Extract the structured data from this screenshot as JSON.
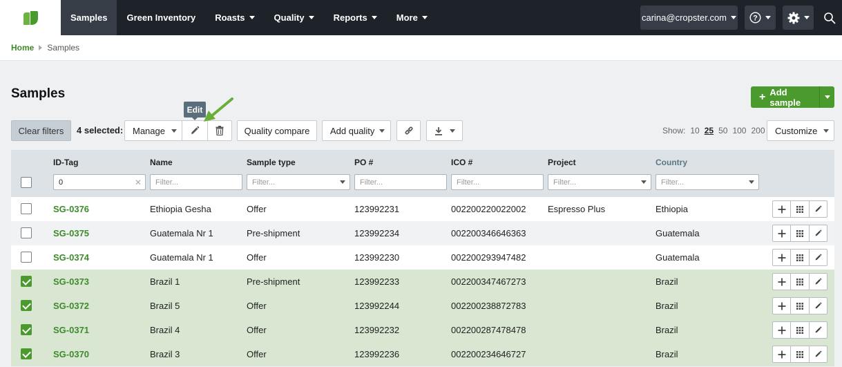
{
  "nav": {
    "items": [
      {
        "label": "Samples",
        "active": true,
        "caret": false
      },
      {
        "label": "Green Inventory",
        "active": false,
        "caret": false
      },
      {
        "label": "Roasts",
        "active": false,
        "caret": true
      },
      {
        "label": "Quality",
        "active": false,
        "caret": true
      },
      {
        "label": "Reports",
        "active": false,
        "caret": true
      },
      {
        "label": "More",
        "active": false,
        "caret": true
      }
    ],
    "user": "carina@cropster.com",
    "accent": "#4a9a2e",
    "bg": "#1e2329"
  },
  "breadcrumb": {
    "home": "Home",
    "current": "Samples"
  },
  "page": {
    "title": "Samples",
    "add_label": "Add sample"
  },
  "toolbar": {
    "clear_filters": "Clear filters",
    "selected": "4 selected:",
    "manage": "Manage",
    "tooltip": "Edit",
    "quality_compare": "Quality compare",
    "add_quality": "Add quality",
    "show_label": "Show:",
    "page_sizes": [
      "10",
      "25",
      "50",
      "100",
      "200"
    ],
    "page_size_current": "25",
    "customize": "Customize"
  },
  "table": {
    "columns": [
      "ID-Tag",
      "Name",
      "Sample type",
      "PO #",
      "ICO #",
      "Project",
      "Country"
    ],
    "filters": {
      "id_tag_value": "0",
      "placeholder": "Filter..."
    },
    "rows": [
      {
        "id": "SG-0376",
        "name": "Ethiopia Gesha",
        "type": "Offer",
        "po": "123992231",
        "ico": "002200220022002",
        "project": "Espresso Plus",
        "country": "Ethiopia",
        "checked": false
      },
      {
        "id": "SG-0375",
        "name": "Guatemala Nr 1",
        "type": "Pre-shipment",
        "po": "123992234",
        "ico": "002200346646363",
        "project": "",
        "country": "Guatemala",
        "checked": false
      },
      {
        "id": "SG-0374",
        "name": "Guatemala Nr 1",
        "type": "Offer",
        "po": "123992230",
        "ico": "002200293947482",
        "project": "",
        "country": "Guatemala",
        "checked": false
      },
      {
        "id": "SG-0373",
        "name": "Brazil 1",
        "type": "Pre-shipment",
        "po": "123992233",
        "ico": "002200347467273",
        "project": "",
        "country": "Brazil",
        "checked": true
      },
      {
        "id": "SG-0372",
        "name": "Brazil 5",
        "type": "Offer",
        "po": "123992244",
        "ico": "002200238872783",
        "project": "",
        "country": "Brazil",
        "checked": true
      },
      {
        "id": "SG-0371",
        "name": "Brazil 4",
        "type": "Offer",
        "po": "123992232",
        "ico": "002200287478478",
        "project": "",
        "country": "Brazil",
        "checked": true
      },
      {
        "id": "SG-0370",
        "name": "Brazil 3",
        "type": "Offer",
        "po": "123992236",
        "ico": "002200234646727",
        "project": "",
        "country": "Brazil",
        "checked": true
      }
    ]
  }
}
